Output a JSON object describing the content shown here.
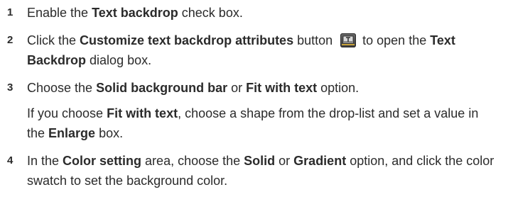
{
  "steps": [
    {
      "number": "1",
      "t1": "Enable the ",
      "b1": "Text backdrop",
      "t2": " check box."
    },
    {
      "number": "2",
      "t1": "Click the ",
      "b1": "Customize text backdrop attributes",
      "t2": " button ",
      "icon": "text-backdrop-attributes-icon",
      "t3": " to open the ",
      "b2": "Text Backdrop",
      "t4": " dialog box."
    },
    {
      "number": "3",
      "t1": "Choose the ",
      "b1": "Solid background bar",
      "t2": " or ",
      "b2": "Fit with text",
      "t3": " option."
    },
    {
      "number": "4",
      "t1": "In the ",
      "b1": "Color setting",
      "t2": " area, choose the ",
      "b2": "Solid",
      "t3": " or ",
      "b3": "Gradient",
      "t4": " option, and click the color swatch to set the background color."
    }
  ],
  "note": {
    "t1": "If you choose ",
    "b1": "Fit with text",
    "t2": ", choose a shape from the drop-list and set a value in the ",
    "b2": "Enlarge",
    "t3": " box."
  }
}
